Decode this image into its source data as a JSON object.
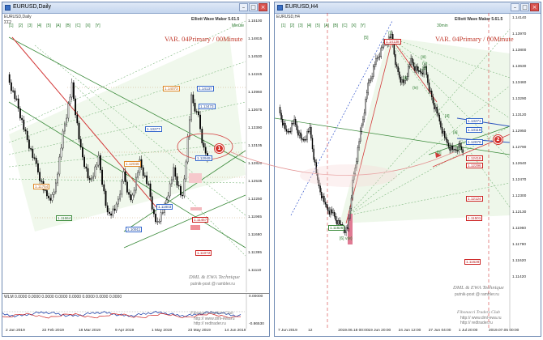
{
  "left_window": {
    "title": "EURUSD,Daily",
    "chart_label": "EURUSD,Daily",
    "indicator_name": "Elliott Wave Maker 5.61.5",
    "timeframe_tag": "Minute",
    "top_letters": [
      "[1]",
      "[2]",
      "[3]",
      "[4]",
      "[5]",
      "[A]",
      "[B]",
      "[C]",
      "[X]",
      "[Y]"
    ],
    "var_text": "VAR. 04Primary / 00Minute",
    "dml_line1": "DML & EWA Technique",
    "dml_line2": "putnik-post @ rambler.ru",
    "fib_line1": "Fibonacci   Traders   Club",
    "fib_line2": "http:// www.dml-ewa.ru",
    "fib_line3": "http:// redtrader.ru",
    "subwindow_label": "WLM 0.0000 0.0000 0.0000 0.0000 0.0000 0.0000 0.0000 0.0000",
    "subwindow_right": "0.00000",
    "subwindow_bottom": "-0.86530",
    "price_axis": [
      "1.15100",
      "1.14815",
      "1.14530",
      "1.14245",
      "1.13960",
      "1.13675",
      "1.13390",
      "1.13105",
      "1.12820",
      "1.12535",
      "1.12250",
      "1.11965",
      "1.11680",
      "1.11395",
      "1.11110"
    ],
    "date_axis": [
      "2 Jan 2019",
      "22 Feb 2019",
      "18 Mar 2019",
      "9 Apr 2019",
      "1 May 2019",
      "23 May 2019",
      "14 Jun 2019"
    ],
    "price_labels": [
      {
        "text": "1.14137",
        "kind": "blue"
      },
      {
        "text": "1.14073",
        "kind": "blue"
      },
      {
        "text": "1.13473",
        "kind": "blue"
      },
      {
        "text": "1.13277",
        "kind": "blue"
      },
      {
        "text": "1.12949",
        "kind": "blue"
      },
      {
        "text": "1.12046",
        "kind": "orange"
      },
      {
        "text": "1.11803",
        "kind": "blue"
      },
      {
        "text": "1.11754",
        "kind": "orange"
      },
      {
        "text": "1.11664",
        "kind": "green"
      },
      {
        "text": "1.11457",
        "kind": "red"
      },
      {
        "text": "1.10911",
        "kind": "blue"
      },
      {
        "text": "1.11072",
        "kind": "red"
      }
    ],
    "marker": "1"
  },
  "right_window": {
    "title": "EURUSD,H4",
    "chart_label": "EURUSD,H4",
    "indicator_name": "Elliott Wave Maker 5.61.5",
    "timeframe_tag": "30min",
    "top_letters": [
      "[1]",
      "[2]",
      "[3]",
      "[4]",
      "[5]",
      "[A]",
      "[B]",
      "[C]",
      "[X]",
      "[Y]"
    ],
    "var_text": "VAR. 04Primary / 00Minute",
    "dml_line1": "DML & EWA Technique",
    "dml_line2": "putnik-post @ rambler.ru",
    "fib_line1": "Fibonacci   Traders   Club",
    "fib_line2": "http:// www.dml-ewa.ru",
    "fib_line3": "http:// redtrader.ru",
    "price_axis": [
      "1.14140",
      "1.13970",
      "1.13800",
      "1.13630",
      "1.13460",
      "1.13290",
      "1.13120",
      "1.12950",
      "1.12790",
      "1.12640",
      "1.12470",
      "1.12300",
      "1.12130",
      "1.11960",
      "1.11790",
      "1.11620",
      "1.11420"
    ],
    "date_axis": [
      "7 Jun 2019",
      "12",
      "2019.06.18 00:00",
      "19 Jun 20:00",
      "24 Jun 12:00",
      "27 Jun 04:00",
      "1 Jul 20:00",
      "2019.07.05 00:00"
    ],
    "price_labels": [
      {
        "text": "1.14138",
        "kind": "red"
      },
      {
        "text": "1.13271",
        "kind": "blue"
      },
      {
        "text": "1.13119",
        "kind": "blue"
      },
      {
        "text": "1.12879",
        "kind": "blue"
      },
      {
        "text": "1.12418",
        "kind": "red"
      },
      {
        "text": "1.12296",
        "kind": "red"
      },
      {
        "text": "1.12124",
        "kind": "red"
      },
      {
        "text": "1.11826",
        "kind": "green"
      },
      {
        "text": "1.11501",
        "kind": "red"
      },
      {
        "text": "1.11628",
        "kind": "red"
      }
    ],
    "wave_labels": [
      "(i)",
      "(ii)",
      "(iii)",
      "(iv)",
      "(v)",
      "[3]",
      "[4]",
      "[5]",
      "[a]",
      "[b]",
      "[c]",
      "[6] v(e)"
    ],
    "marker": "2"
  },
  "colors": {
    "bull": "#ffffff",
    "bear": "#000000",
    "trend_red": "#d33a3a",
    "fib_green": "#6aa86a",
    "fib_blue": "#5577cc",
    "zone_green": "#e4f3e0",
    "vline_red": "#d33a3a",
    "marker": "#d3312b"
  }
}
